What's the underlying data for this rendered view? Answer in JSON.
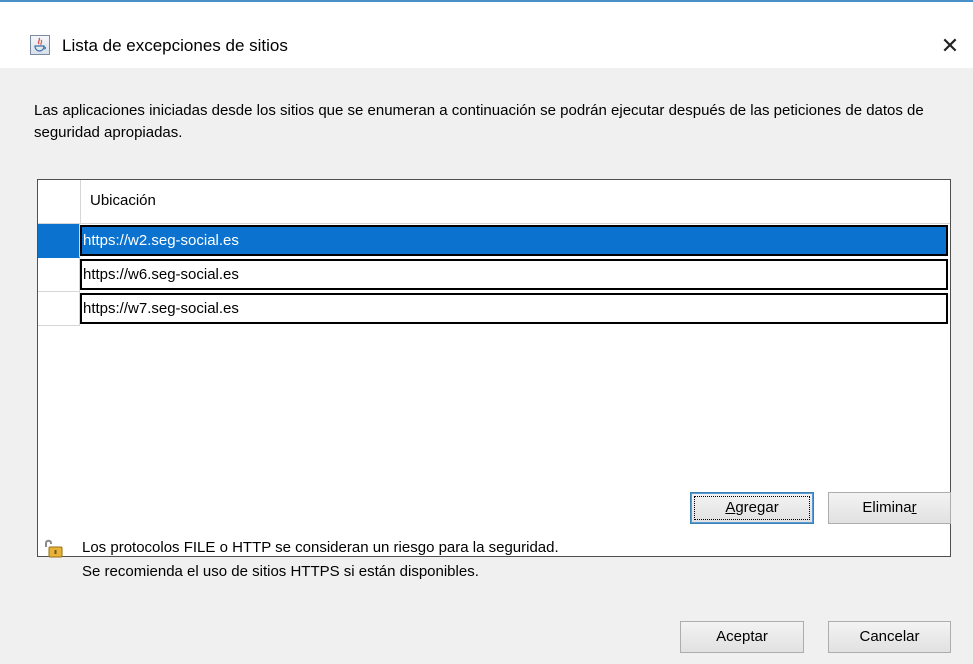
{
  "window": {
    "title": "Lista de excepciones de sitios",
    "close_glyph": "✕",
    "icon": "java-icon",
    "accent_color": "#4a90c8"
  },
  "description": "Las aplicaciones iniciadas desde los sitios que se enumeran a continuación se podrán ejecutar después de las peticiones de datos de seguridad apropiadas.",
  "table": {
    "column_header": "Ubicación",
    "rows": [
      {
        "location": "https://w2.seg-social.es",
        "selected": true
      },
      {
        "location": "https://w6.seg-social.es",
        "selected": false
      },
      {
        "location": "https://w7.seg-social.es",
        "selected": false
      }
    ],
    "selection_color": "#0b73cf"
  },
  "buttons": {
    "add": {
      "prefix": "",
      "mnemonic": "A",
      "rest": "gregar"
    },
    "remove": {
      "prefix": "Elimina",
      "mnemonic": "r",
      "rest": ""
    },
    "ok": "Aceptar",
    "cancel": "Cancelar"
  },
  "warning": {
    "icon": "padlock-icon",
    "line1": "Los protocolos FILE o HTTP se consideran un riesgo para la seguridad.",
    "line2": "Se recomienda el uso de sitios HTTPS si están disponibles."
  }
}
